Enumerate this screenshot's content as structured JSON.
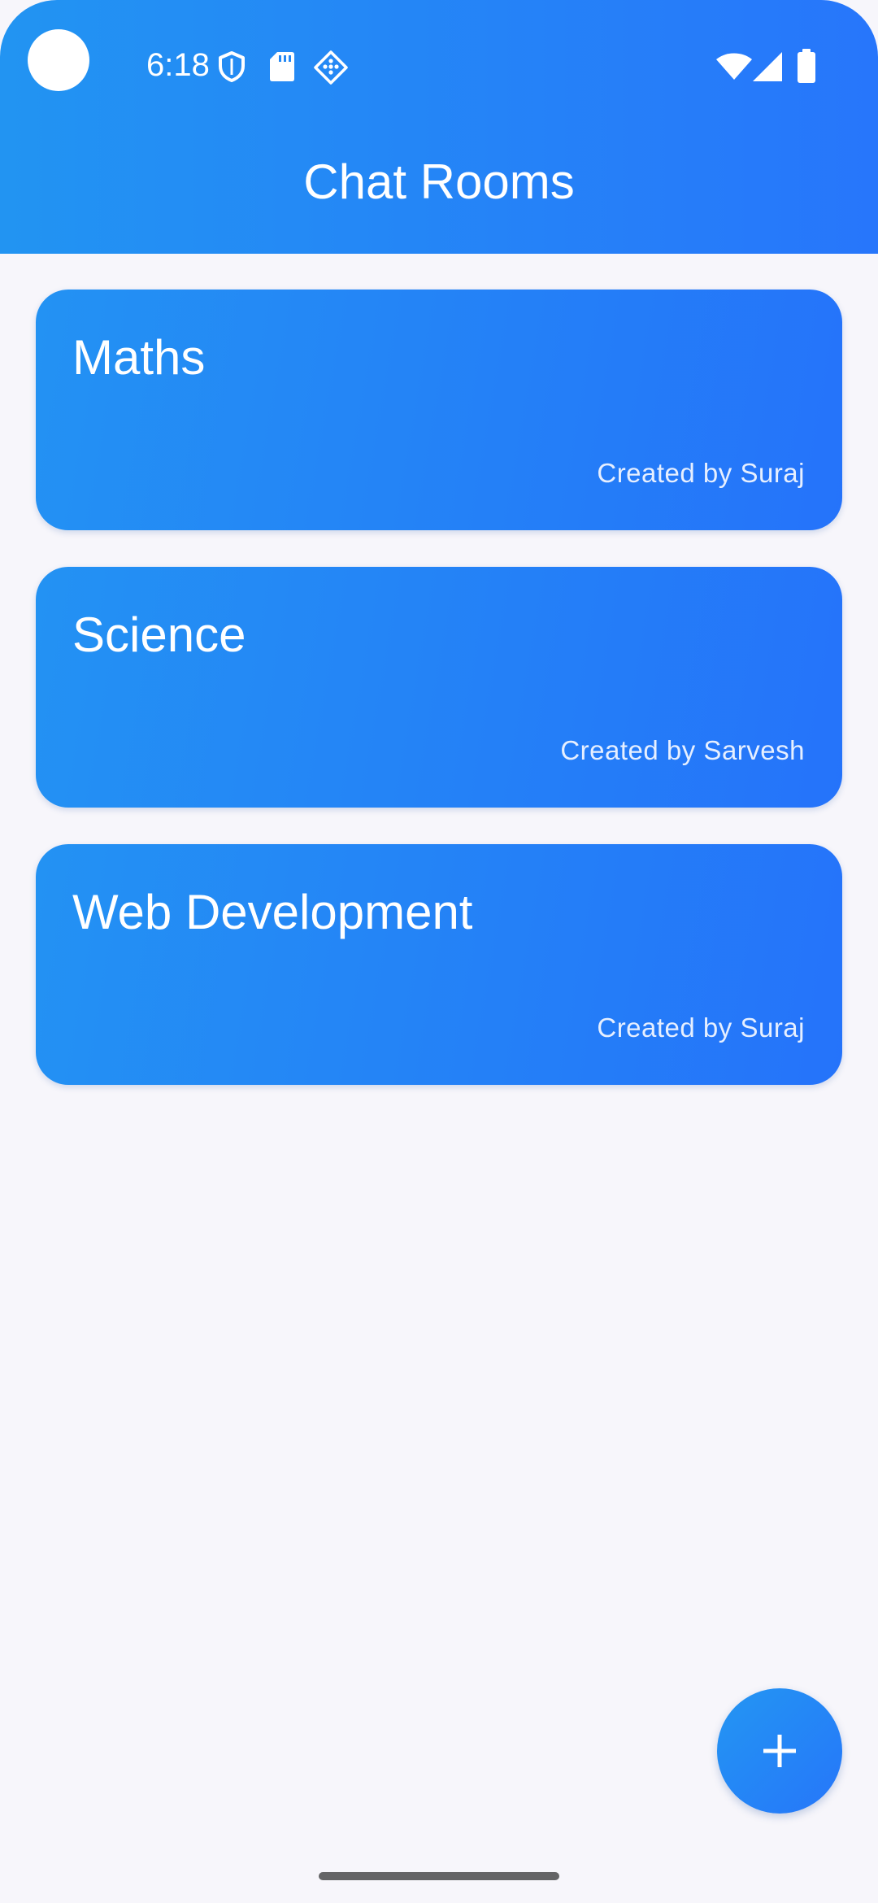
{
  "status_bar": {
    "time": "6:18",
    "icons": [
      "camera-dot",
      "shield-icon",
      "sd-card-icon",
      "diamond-grid-icon",
      "wifi-icon",
      "cell-signal-icon",
      "battery-icon"
    ]
  },
  "app_bar": {
    "title": "Chat Rooms"
  },
  "rooms": [
    {
      "name": "Maths",
      "creator": "Created by Suraj"
    },
    {
      "name": "Science",
      "creator": "Created by Sarvesh"
    },
    {
      "name": "Web Development",
      "creator": "Created by Suraj"
    }
  ],
  "fab": {
    "icon": "plus-icon"
  },
  "colors": {
    "accent_start": "#2294f2",
    "accent_end": "#2776fb",
    "background": "#f7f6fb",
    "text_on_accent": "#ffffff"
  }
}
